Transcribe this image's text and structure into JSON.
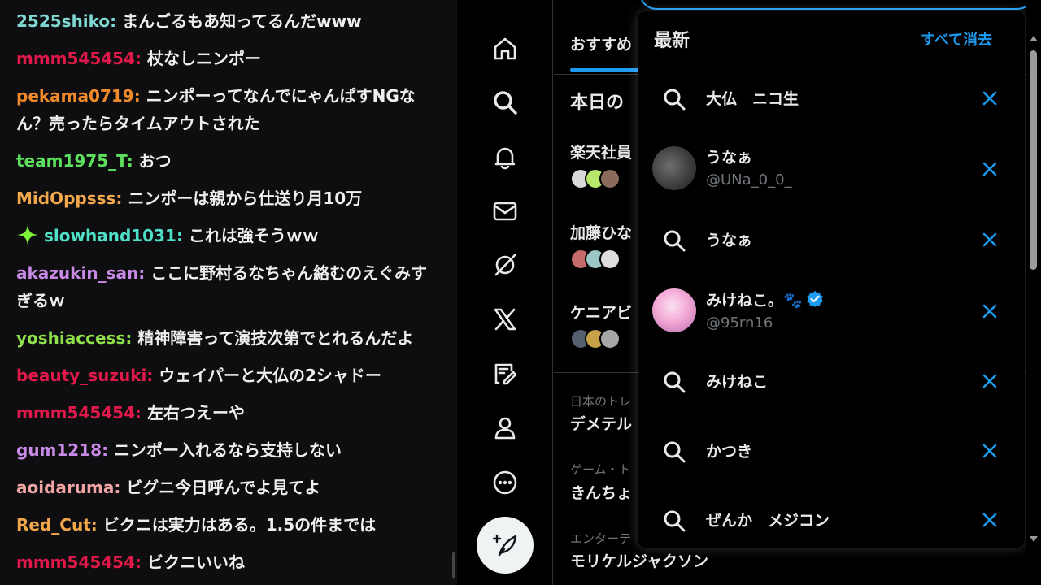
{
  "chat": {
    "messages": [
      {
        "user": "2525shiko",
        "color": "#7fd8d4",
        "text": "まんごるもあ知ってるんだwww"
      },
      {
        "user": "mmm545454",
        "color": "#e0194a",
        "text": "杖なしニンポー"
      },
      {
        "user": "pekama0719",
        "color": "#f08a2a",
        "text": "ニンポーってなんでにゃんぱすNGなん？売ったらタイムアウトされた"
      },
      {
        "user": "team1975_T",
        "color": "#5de05d",
        "text": "おつ"
      },
      {
        "user": "MidOppsss",
        "color": "#f2a84a",
        "text": "ニンポーは親から仕送り月10万"
      },
      {
        "user": "slowhand1031",
        "color": "#4fe0c8",
        "text": "これは強そうｗｗ",
        "badge": "sparkle-icon"
      },
      {
        "user": "akazukin_san",
        "color": "#c88ae6",
        "text": "ここに野村るなちゃん絡むのえぐみすぎるｗ"
      },
      {
        "user": "yoshiaccess",
        "color": "#8de04a",
        "text": "精神障害って演技次第でとれるんだよ"
      },
      {
        "user": "beauty_suzuki",
        "color": "#e0194a",
        "text": "ウェイパーと大仏の2シャドー"
      },
      {
        "user": "mmm545454",
        "color": "#e0194a",
        "text": "左右つえーや"
      },
      {
        "user": "gum1218",
        "color": "#c88ae6",
        "text": "ニンポー入れるなら支持しない"
      },
      {
        "user": "aoidaruma",
        "color": "#f0a4a4",
        "text": "ビグニ今日呼んでよ見てよ"
      },
      {
        "user": "Red_Cut",
        "color": "#f2a84a",
        "text": "ビクニは実力はある。1.5の件までは"
      },
      {
        "user": "mmm545454",
        "color": "#e0194a",
        "text": "ビクニいいね"
      }
    ],
    "separator": ": "
  },
  "nav": {
    "icons": [
      "home-icon",
      "search-icon",
      "notifications-icon",
      "messages-icon",
      "grok-icon",
      "x-premium-icon",
      "lists-icon",
      "profile-icon",
      "more-icon"
    ],
    "compose_icon": "compose-icon"
  },
  "timeline": {
    "tab_label": "おすすめ",
    "today_title": "本日の",
    "items": [
      "楽天社員",
      "加藤ひな",
      "ケニアビ"
    ],
    "trends": [
      {
        "category": "日本のトレ",
        "name": "デメテル"
      },
      {
        "category": "ゲーム・ト",
        "name": "きんちょ"
      },
      {
        "category": "エンターテ",
        "name": "モリケルジャクソン"
      }
    ]
  },
  "search_dropdown": {
    "title": "最新",
    "clear_all": "すべて消去",
    "entries": [
      {
        "kind": "query",
        "text": "大仏　ニコ生"
      },
      {
        "kind": "user",
        "name": "うなぁ",
        "handle": "@UNa_0_0_"
      },
      {
        "kind": "query",
        "text": "うなぁ"
      },
      {
        "kind": "user",
        "name": "みけねこ。🐾",
        "handle": "@95rn16",
        "verified": true
      },
      {
        "kind": "query",
        "text": "みけねこ"
      },
      {
        "kind": "query",
        "text": "かつき"
      },
      {
        "kind": "query",
        "text": "ぜんか　メジコン"
      }
    ]
  },
  "colors": {
    "accent": "#1d9bf0",
    "chat_bg": "#0e0e10",
    "x_bg": "#000000",
    "muted": "#71767b"
  }
}
